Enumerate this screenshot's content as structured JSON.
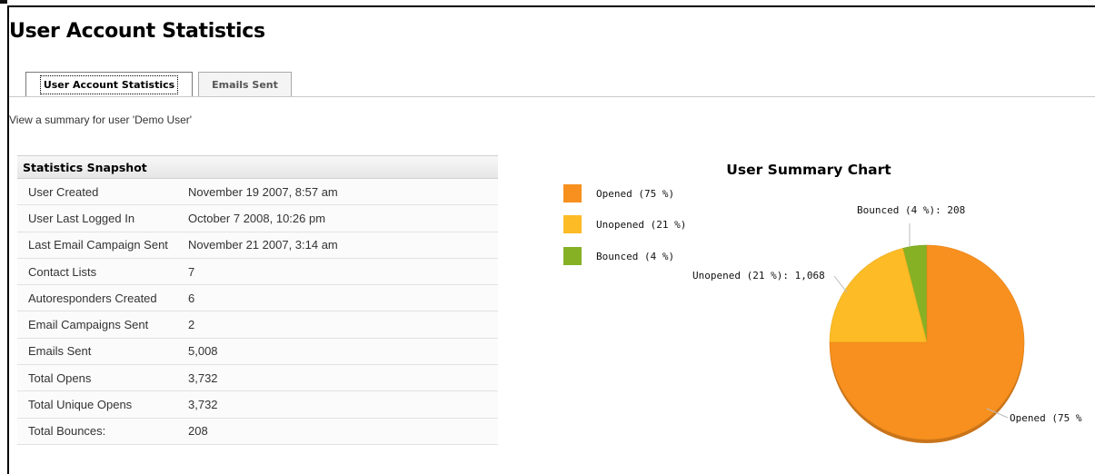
{
  "page": {
    "title": "User Account Statistics",
    "summary": "View a summary for user 'Demo User'"
  },
  "tabs": [
    {
      "label": "User Account Statistics",
      "active": true
    },
    {
      "label": "Emails Sent",
      "active": false
    }
  ],
  "snapshot": {
    "header": "Statistics Snapshot",
    "rows": [
      {
        "label": "User Created",
        "value": "November 19 2007, 8:57 am"
      },
      {
        "label": "User Last Logged In",
        "value": "October 7 2008, 10:26 pm"
      },
      {
        "label": "Last Email Campaign Sent",
        "value": "November 21 2007, 3:14 am"
      },
      {
        "label": "Contact Lists",
        "value": "7"
      },
      {
        "label": "Autoresponders Created",
        "value": "6"
      },
      {
        "label": "Email Campaigns Sent",
        "value": "2"
      },
      {
        "label": "Emails Sent",
        "value": "5,008"
      },
      {
        "label": "Total Opens",
        "value": "3,732"
      },
      {
        "label": "Total Unique Opens",
        "value": "3,732"
      },
      {
        "label": "Total Bounces:",
        "value": "208"
      }
    ]
  },
  "chart_data": {
    "type": "pie",
    "title": "User Summary Chart",
    "legend_position": "left",
    "slices": [
      {
        "name": "Opened",
        "legend": "Opened (75 %)",
        "value": 75,
        "count_label": "Opened (75 %",
        "color": "#f7901e"
      },
      {
        "name": "Unopened",
        "legend": "Unopened (21 %)",
        "value": 21,
        "count_label": "Unopened (21 %): 1,068",
        "color": "#fdbb25"
      },
      {
        "name": "Bounced",
        "legend": "Bounced (4 %)",
        "value": 4,
        "count_label": "Bounced (4 %): 208",
        "color": "#86b125"
      }
    ]
  }
}
